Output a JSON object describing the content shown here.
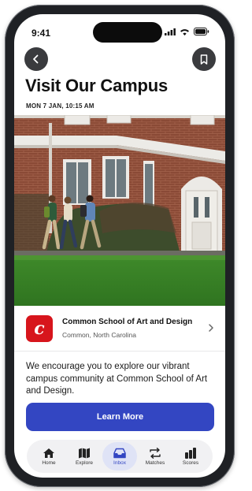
{
  "status_bar": {
    "time": "9:41"
  },
  "header": {
    "title": "Visit Our Campus",
    "date": "MON 7 JAN, 10:15 AM"
  },
  "school": {
    "logo_letter": "c",
    "name": "Common School of Art and Design",
    "location": "Common, North Carolina"
  },
  "description": "We encourage you to explore our vibrant campus community at Common School of Art and Design.",
  "cta": {
    "label": "Learn More"
  },
  "tabs": [
    {
      "label": "Home",
      "icon": "home-icon"
    },
    {
      "label": "Explore",
      "icon": "map-icon"
    },
    {
      "label": "Inbox",
      "icon": "inbox-icon",
      "active": true
    },
    {
      "label": "Matches",
      "icon": "matches-icon"
    },
    {
      "label": "Scores",
      "icon": "scores-icon"
    }
  ],
  "colors": {
    "accent": "#3346c2",
    "logo_red": "#d7151c",
    "nav_button": "#3a3b3e"
  }
}
